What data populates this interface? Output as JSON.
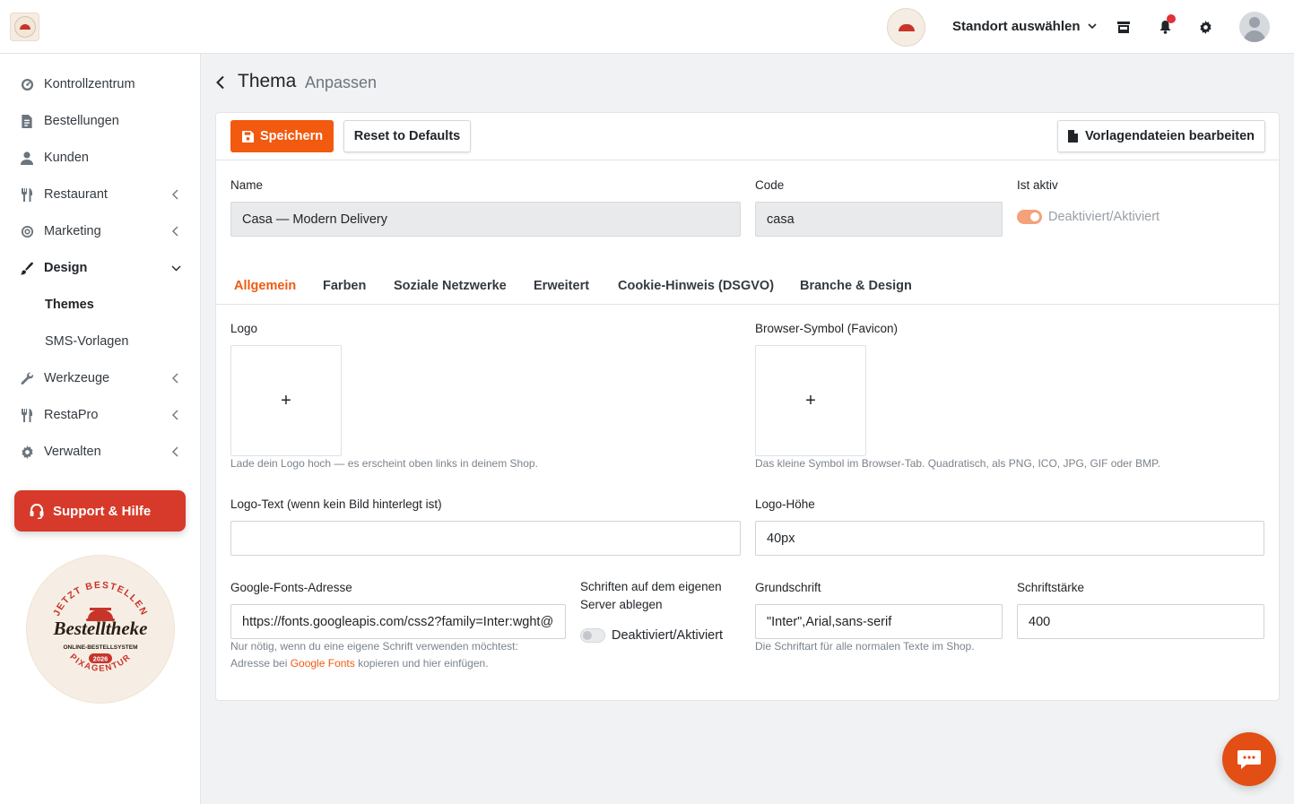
{
  "header": {
    "location_label": "Standort auswählen"
  },
  "sidebar": {
    "items": [
      {
        "label": "Kontrollzentrum",
        "icon": "dashboard-icon"
      },
      {
        "label": "Bestellungen",
        "icon": "receipt-icon"
      },
      {
        "label": "Kunden",
        "icon": "user-icon"
      },
      {
        "label": "Restaurant",
        "icon": "cutlery-icon"
      },
      {
        "label": "Marketing",
        "icon": "bullseye-icon"
      },
      {
        "label": "Design",
        "icon": "brush-icon"
      },
      {
        "label": "Themes"
      },
      {
        "label": "SMS-Vorlagen"
      },
      {
        "label": "Werkzeuge",
        "icon": "wrench-icon"
      },
      {
        "label": "RestaPro",
        "icon": "cutlery-icon"
      },
      {
        "label": "Verwalten",
        "icon": "gear-icon"
      }
    ],
    "support_label": "Support & Hilfe",
    "seal": {
      "arc_top": "JETZT BESTELLEN",
      "brand": "Bestelltheke",
      "tagline": "ONLINE-BESTELLSYSTEM",
      "year": "2026",
      "arc_bottom": "PIXAGENTUR"
    }
  },
  "page": {
    "title": "Thema",
    "subtitle": "Anpassen"
  },
  "toolbar": {
    "save_label": "Speichern",
    "reset_label": "Reset to Defaults",
    "templates_label": "Vorlagendateien bearbeiten"
  },
  "form": {
    "name_label": "Name",
    "name_value": "Casa — Modern Delivery",
    "code_label": "Code",
    "code_value": "casa",
    "active_label": "Ist aktiv",
    "active_toggle_label": "Deaktiviert/Aktiviert",
    "active_on": true
  },
  "tabs": [
    "Allgemein",
    "Farben",
    "Soziale Netzwerke",
    "Erweitert",
    "Cookie-Hinweis (DSGVO)",
    "Branche & Design"
  ],
  "general": {
    "logo_label": "Logo",
    "logo_help": "Lade dein Logo hoch — es erscheint oben links in deinem Shop.",
    "favicon_label": "Browser-Symbol (Favicon)",
    "favicon_help": "Das kleine Symbol im Browser-Tab. Quadratisch, als PNG, ICO, JPG, GIF oder BMP.",
    "upload_plus": "+",
    "logo_text_label": "Logo-Text (wenn kein Bild hinterlegt ist)",
    "logo_text_value": "",
    "logo_height_label": "Logo-Höhe",
    "logo_height_value": "40px",
    "fonts_url_label": "Google-Fonts-Adresse",
    "fonts_url_value": "https://fonts.googleapis.com/css2?family=Inter:wght@",
    "fonts_url_help_1": "Nur nötig, wenn du eine eigene Schrift verwenden möchtest:",
    "fonts_url_help_2a": "Adresse bei ",
    "fonts_url_help_link": "Google Fonts",
    "fonts_url_help_2b": " kopieren und hier einfügen.",
    "self_host_label_1": "Schriften auf dem eigenen",
    "self_host_label_2": "Server ablegen",
    "self_host_toggle_label": "Deaktiviert/Aktiviert",
    "self_host_on": false,
    "base_font_label": "Grundschrift",
    "base_font_value": "\"Inter\",Arial,sans-serif",
    "base_font_help": "Die Schriftart für alle normalen Texte im Shop.",
    "font_weight_label": "Schriftstärke",
    "font_weight_value": "400"
  },
  "colors": {
    "accent": "#f15a0f",
    "support": "#d73a2a",
    "toggle_on": "#f4a27a"
  }
}
